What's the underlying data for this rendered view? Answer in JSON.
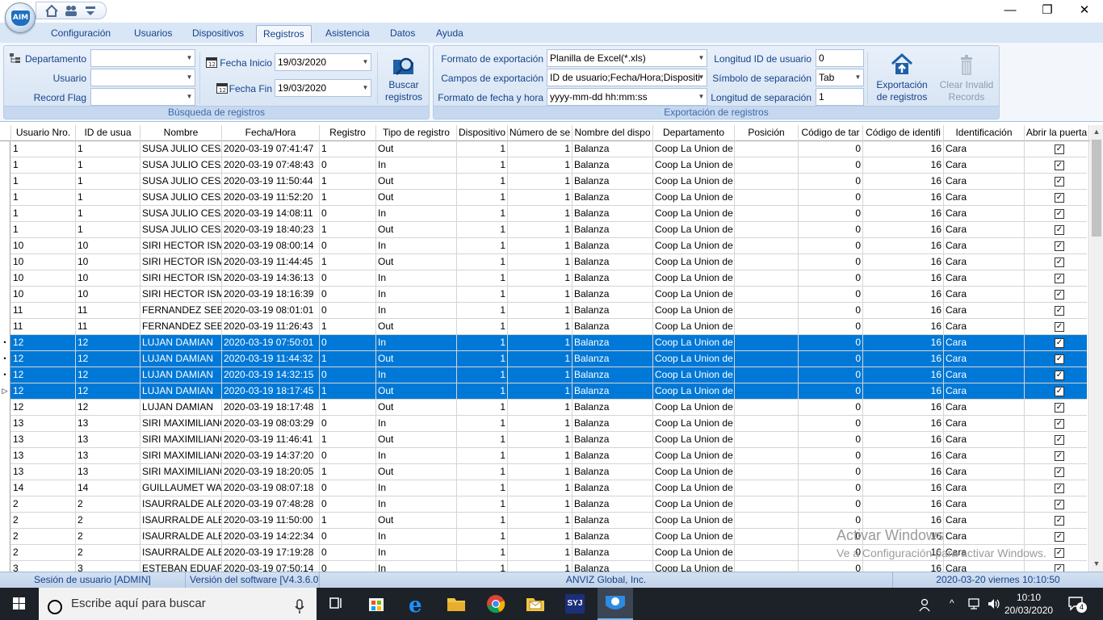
{
  "window": {
    "minimize": "—",
    "restore": "❐",
    "close": "✕"
  },
  "logo": {
    "text": "AIM"
  },
  "tabs": [
    "Configuración",
    "Usuarios",
    "Dispositivos",
    "Registros",
    "Asistencia",
    "Datos",
    "Ayuda"
  ],
  "search_group": {
    "caption": "Búsqueda de registros",
    "department_label": "Departamento",
    "department_value": "",
    "user_label": "Usuario",
    "user_value": "",
    "flag_label": "Record Flag",
    "flag_value": "",
    "start_label": "Fecha Inicio",
    "start_value": "19/03/2020",
    "end_label": "Fecha Fin",
    "end_value": "19/03/2020",
    "search_button": [
      "Buscar",
      "registros"
    ]
  },
  "export_group": {
    "caption": "Exportación de registros",
    "format_label": "Formato de exportación",
    "format_value": "Planilla de Excel(*.xls)",
    "fields_label": "Campos de exportación",
    "fields_value": "ID de usuario;Fecha/Hora;Dispositi",
    "dateformat_label": "Formato de fecha y hora",
    "dateformat_value": "yyyy-mm-dd hh:mm:ss",
    "idlen_label": "Longitud ID de usuario",
    "idlen_value": "0",
    "sepsym_label": "Símbolo de separación",
    "sepsym_value": "Tab",
    "seplen_label": "Longitud de separación",
    "seplen_value": "1",
    "export_button": [
      "Exportación",
      "de registros"
    ],
    "clear_button": [
      "Clear Invalid",
      "Records"
    ]
  },
  "grid": {
    "columns": [
      "Usuario Nro.",
      "ID de usua",
      "Nombre",
      "Fecha/Hora",
      "Registro",
      "Tipo de registro",
      "Dispositivo",
      "Número de se",
      "Nombre del dispo",
      "Departamento",
      "Posición",
      "Código de tar",
      "Código de identifi",
      "Identificación",
      "Abrir la puerta"
    ],
    "rows": [
      [
        "1",
        "1",
        "SUSA JULIO CESAR",
        "2020-03-19 07:41:47",
        "1",
        "Out",
        "1",
        "1",
        "Balanza",
        "Coop La Union de",
        "",
        "0",
        "16",
        "Cara",
        "✓"
      ],
      [
        "1",
        "1",
        "SUSA JULIO CESAR",
        "2020-03-19 07:48:43",
        "0",
        "In",
        "1",
        "1",
        "Balanza",
        "Coop La Union de",
        "",
        "0",
        "16",
        "Cara",
        "✓"
      ],
      [
        "1",
        "1",
        "SUSA JULIO CESAR",
        "2020-03-19 11:50:44",
        "1",
        "Out",
        "1",
        "1",
        "Balanza",
        "Coop La Union de",
        "",
        "0",
        "16",
        "Cara",
        "✓"
      ],
      [
        "1",
        "1",
        "SUSA JULIO CESAR",
        "2020-03-19 11:52:20",
        "1",
        "Out",
        "1",
        "1",
        "Balanza",
        "Coop La Union de",
        "",
        "0",
        "16",
        "Cara",
        "✓"
      ],
      [
        "1",
        "1",
        "SUSA JULIO CESAR",
        "2020-03-19 14:08:11",
        "0",
        "In",
        "1",
        "1",
        "Balanza",
        "Coop La Union de",
        "",
        "0",
        "16",
        "Cara",
        "✓"
      ],
      [
        "1",
        "1",
        "SUSA JULIO CESAR",
        "2020-03-19 18:40:23",
        "1",
        "Out",
        "1",
        "1",
        "Balanza",
        "Coop La Union de",
        "",
        "0",
        "16",
        "Cara",
        "✓"
      ],
      [
        "10",
        "10",
        "SIRI HECTOR ISMAEL",
        "2020-03-19 08:00:14",
        "0",
        "In",
        "1",
        "1",
        "Balanza",
        "Coop La Union de",
        "",
        "0",
        "16",
        "Cara",
        "✓"
      ],
      [
        "10",
        "10",
        "SIRI HECTOR ISMAEL",
        "2020-03-19 11:44:45",
        "1",
        "Out",
        "1",
        "1",
        "Balanza",
        "Coop La Union de",
        "",
        "0",
        "16",
        "Cara",
        "✓"
      ],
      [
        "10",
        "10",
        "SIRI HECTOR ISMAEL",
        "2020-03-19 14:36:13",
        "0",
        "In",
        "1",
        "1",
        "Balanza",
        "Coop La Union de",
        "",
        "0",
        "16",
        "Cara",
        "✓"
      ],
      [
        "10",
        "10",
        "SIRI HECTOR ISMAEL",
        "2020-03-19 18:16:39",
        "0",
        "In",
        "1",
        "1",
        "Balanza",
        "Coop La Union de",
        "",
        "0",
        "16",
        "Cara",
        "✓"
      ],
      [
        "11",
        "11",
        "FERNANDEZ SEBASTIAN",
        "2020-03-19 08:01:01",
        "0",
        "In",
        "1",
        "1",
        "Balanza",
        "Coop La Union de",
        "",
        "0",
        "16",
        "Cara",
        "✓"
      ],
      [
        "11",
        "11",
        "FERNANDEZ SEBASTIAN",
        "2020-03-19 11:26:43",
        "1",
        "Out",
        "1",
        "1",
        "Balanza",
        "Coop La Union de",
        "",
        "0",
        "16",
        "Cara",
        "✓"
      ],
      [
        "12",
        "12",
        "LUJAN DAMIAN",
        "2020-03-19 07:50:01",
        "0",
        "In",
        "1",
        "1",
        "Balanza",
        "Coop La Union de",
        "",
        "0",
        "16",
        "Cara",
        "✓"
      ],
      [
        "12",
        "12",
        "LUJAN DAMIAN",
        "2020-03-19 11:44:32",
        "1",
        "Out",
        "1",
        "1",
        "Balanza",
        "Coop La Union de",
        "",
        "0",
        "16",
        "Cara",
        "✓"
      ],
      [
        "12",
        "12",
        "LUJAN DAMIAN",
        "2020-03-19 14:32:15",
        "0",
        "In",
        "1",
        "1",
        "Balanza",
        "Coop La Union de",
        "",
        "0",
        "16",
        "Cara",
        "✓"
      ],
      [
        "12",
        "12",
        "LUJAN DAMIAN",
        "2020-03-19 18:17:45",
        "1",
        "Out",
        "1",
        "1",
        "Balanza",
        "Coop La Union de",
        "",
        "0",
        "16",
        "Cara",
        "✓"
      ],
      [
        "12",
        "12",
        "LUJAN DAMIAN",
        "2020-03-19 18:17:48",
        "1",
        "Out",
        "1",
        "1",
        "Balanza",
        "Coop La Union de",
        "",
        "0",
        "16",
        "Cara",
        "✓"
      ],
      [
        "13",
        "13",
        "SIRI MAXIMILIANO",
        "2020-03-19 08:03:29",
        "0",
        "In",
        "1",
        "1",
        "Balanza",
        "Coop La Union de",
        "",
        "0",
        "16",
        "Cara",
        "✓"
      ],
      [
        "13",
        "13",
        "SIRI MAXIMILIANO",
        "2020-03-19 11:46:41",
        "1",
        "Out",
        "1",
        "1",
        "Balanza",
        "Coop La Union de",
        "",
        "0",
        "16",
        "Cara",
        "✓"
      ],
      [
        "13",
        "13",
        "SIRI MAXIMILIANO",
        "2020-03-19 14:37:20",
        "0",
        "In",
        "1",
        "1",
        "Balanza",
        "Coop La Union de",
        "",
        "0",
        "16",
        "Cara",
        "✓"
      ],
      [
        "13",
        "13",
        "SIRI MAXIMILIANO",
        "2020-03-19 18:20:05",
        "1",
        "Out",
        "1",
        "1",
        "Balanza",
        "Coop La Union de",
        "",
        "0",
        "16",
        "Cara",
        "✓"
      ],
      [
        "14",
        "14",
        "GUILLAUMET WALTER",
        "2020-03-19 08:07:18",
        "0",
        "In",
        "1",
        "1",
        "Balanza",
        "Coop La Union de",
        "",
        "0",
        "16",
        "Cara",
        "✓"
      ],
      [
        "2",
        "2",
        "ISAURRALDE ALBERTO",
        "2020-03-19 07:48:28",
        "0",
        "In",
        "1",
        "1",
        "Balanza",
        "Coop La Union de",
        "",
        "0",
        "16",
        "Cara",
        "✓"
      ],
      [
        "2",
        "2",
        "ISAURRALDE ALBERTO",
        "2020-03-19 11:50:00",
        "1",
        "Out",
        "1",
        "1",
        "Balanza",
        "Coop La Union de",
        "",
        "0",
        "16",
        "Cara",
        "✓"
      ],
      [
        "2",
        "2",
        "ISAURRALDE ALBERTO",
        "2020-03-19 14:22:34",
        "0",
        "In",
        "1",
        "1",
        "Balanza",
        "Coop La Union de",
        "",
        "0",
        "16",
        "Cara",
        "✓"
      ],
      [
        "2",
        "2",
        "ISAURRALDE ALBERTO",
        "2020-03-19 17:19:28",
        "0",
        "In",
        "1",
        "1",
        "Balanza",
        "Coop La Union de",
        "",
        "0",
        "16",
        "Cara",
        "✓"
      ],
      [
        "3",
        "3",
        "ESTEBAN EDUARDO",
        "2020-03-19 07:50:14",
        "0",
        "In",
        "1",
        "1",
        "Balanza",
        "Coop La Union de",
        "",
        "0",
        "16",
        "Cara",
        "✓"
      ]
    ],
    "selected_rows": [
      12,
      13,
      14,
      15
    ],
    "current_row": 15
  },
  "status": {
    "session": "Sesión de usuario  [ADMIN]",
    "version": "Versión del software  [V4.3.6.0]",
    "company": "ANVIZ Global, Inc.",
    "datetime": "2020-03-20 viernes 10:10:50"
  },
  "watermark": {
    "line1": "Activar Windows",
    "line2": "Ve a Configuración para activar Windows."
  },
  "taskbar": {
    "search_placeholder": "Escribe aquí para buscar",
    "time": "10:10",
    "date": "20/03/2020",
    "notifications": "4",
    "syj_label": "SYJ"
  },
  "colors": {
    "selection": "#0078d7",
    "ribbon_text": "#15428b",
    "taskbar": "#1d2228"
  }
}
